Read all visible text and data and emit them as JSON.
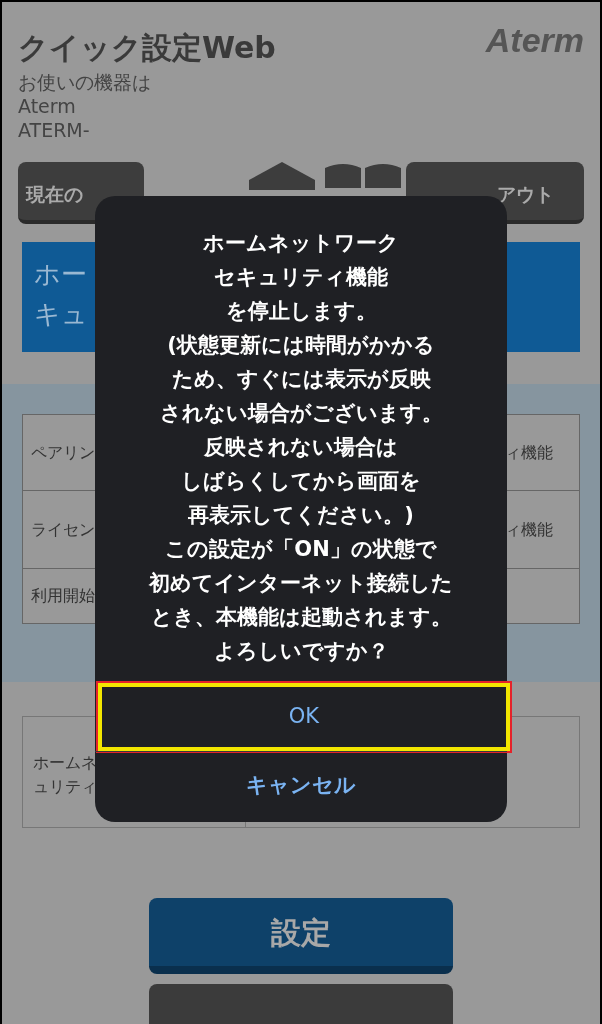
{
  "header": {
    "title": "クイック設定Web",
    "logo": "Aterm",
    "device_lines": [
      "お使いの機器は",
      "Aterm",
      "ATERM-"
    ]
  },
  "nav": {
    "left_button": "現在の",
    "right_button": "アウト"
  },
  "banner": {
    "lines": [
      "ホー",
      "キュ"
    ]
  },
  "info_table": {
    "rows": [
      {
        "column_1": "ペアリン",
        "column_2": "ィ機能"
      },
      {
        "column_1": "ライセン",
        "column_2": "ィ機能"
      },
      {
        "column_1": "利用開始"
      }
    ]
  },
  "setting_table": {
    "label_lines": [
      "ホームネ",
      "ュリティ"
    ]
  },
  "set_button": "設定",
  "dialog": {
    "message_lines": [
      "ホームネットワーク",
      "セキュリティ機能",
      "を停止します。",
      "(状態更新には時間がかかる",
      "ため、すぐには表示が反映",
      "されない場合がございます。",
      "反映されない場合は",
      "しばらくしてから画面を",
      "再表示してください。)",
      "この設定が「ON」の状態で",
      "初めてインターネット接続した",
      "とき、本機能は起動されます。",
      "よろしいですか？"
    ],
    "buttons": [
      {
        "label": "OK",
        "kind": "default",
        "highlighted": true
      },
      {
        "label": "キャンセル",
        "kind": "cancel",
        "highlighted": false
      }
    ]
  }
}
